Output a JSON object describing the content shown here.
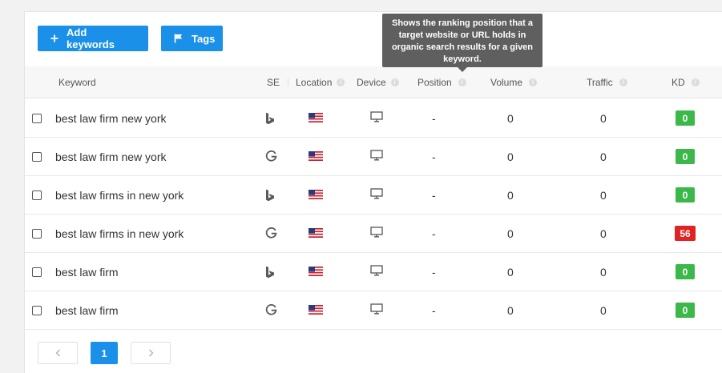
{
  "toolbar": {
    "add_keywords_label": "Add keywords",
    "tags_label": "Tags"
  },
  "tooltip": {
    "text": "Shows the ranking position that a target website or URL holds in organic search results for a given keyword."
  },
  "table": {
    "columns": {
      "keyword": "Keyword",
      "se": "SE",
      "location": "Location",
      "device": "Device",
      "position": "Position",
      "volume": "Volume",
      "traffic": "Traffic",
      "kd": "KD"
    },
    "rows": [
      {
        "keyword": "best law firm new york",
        "se": "bing",
        "location": "US",
        "device": "desktop",
        "position": "-",
        "volume": "0",
        "traffic": "0",
        "kd": "0"
      },
      {
        "keyword": "best law firm new york",
        "se": "google",
        "location": "US",
        "device": "desktop",
        "position": "-",
        "volume": "0",
        "traffic": "0",
        "kd": "0"
      },
      {
        "keyword": "best law firms in new york",
        "se": "bing",
        "location": "US",
        "device": "desktop",
        "position": "-",
        "volume": "0",
        "traffic": "0",
        "kd": "0"
      },
      {
        "keyword": "best law firms in new york",
        "se": "google",
        "location": "US",
        "device": "desktop",
        "position": "-",
        "volume": "0",
        "traffic": "0",
        "kd": "56"
      },
      {
        "keyword": "best law firm",
        "se": "bing",
        "location": "US",
        "device": "desktop",
        "position": "-",
        "volume": "0",
        "traffic": "0",
        "kd": "0"
      },
      {
        "keyword": "best law firm",
        "se": "google",
        "location": "US",
        "device": "desktop",
        "position": "-",
        "volume": "0",
        "traffic": "0",
        "kd": "0"
      }
    ]
  },
  "pagination": {
    "current_page": "1",
    "prev_icon": "chevron-left-icon",
    "next_icon": "chevron-right-icon"
  },
  "colors": {
    "accent": "#1a90e8",
    "kd_low": "#3cb84a",
    "kd_high": "#e02424",
    "tooltip_bg": "#5f5f5f"
  }
}
